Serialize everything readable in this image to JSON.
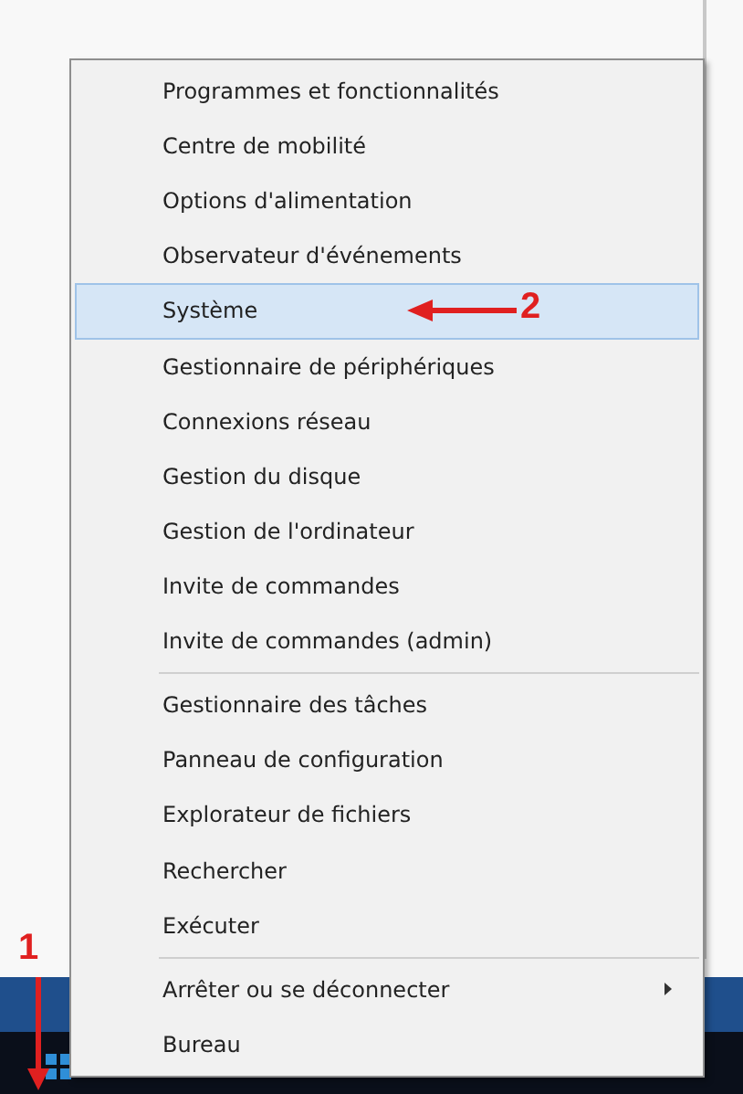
{
  "context_menu": {
    "groups": [
      {
        "items": [
          {
            "label": "Programmes et fonctionnalités",
            "selected": false,
            "submenu": false
          },
          {
            "label": "Centre de mobilité",
            "selected": false,
            "submenu": false
          },
          {
            "label": "Options d'alimentation",
            "selected": false,
            "submenu": false
          },
          {
            "label": "Observateur d'événements",
            "selected": false,
            "submenu": false
          },
          {
            "label": "Système",
            "selected": true,
            "submenu": false
          },
          {
            "label": "Gestionnaire de périphériques",
            "selected": false,
            "submenu": false
          },
          {
            "label": "Connexions réseau",
            "selected": false,
            "submenu": false
          },
          {
            "label": "Gestion du disque",
            "selected": false,
            "submenu": false
          },
          {
            "label": "Gestion de l'ordinateur",
            "selected": false,
            "submenu": false
          },
          {
            "label": "Invite de commandes",
            "selected": false,
            "submenu": false
          },
          {
            "label": "Invite de commandes (admin)",
            "selected": false,
            "submenu": false
          }
        ]
      },
      {
        "items": [
          {
            "label": "Gestionnaire des tâches",
            "selected": false,
            "submenu": false
          },
          {
            "label": "Panneau de configuration",
            "selected": false,
            "submenu": false
          },
          {
            "label": "Explorateur de fichiers",
            "selected": false,
            "submenu": false
          },
          {
            "label": "Rechercher",
            "selected": false,
            "submenu": false
          },
          {
            "label": "Exécuter",
            "selected": false,
            "submenu": false
          }
        ]
      },
      {
        "items": [
          {
            "label": "Arrêter ou se déconnecter",
            "selected": false,
            "submenu": true
          },
          {
            "label": "Bureau",
            "selected": false,
            "submenu": false
          }
        ]
      }
    ]
  },
  "annotations": [
    {
      "kind": "down",
      "number": "1"
    },
    {
      "kind": "left",
      "number": "2"
    }
  ]
}
